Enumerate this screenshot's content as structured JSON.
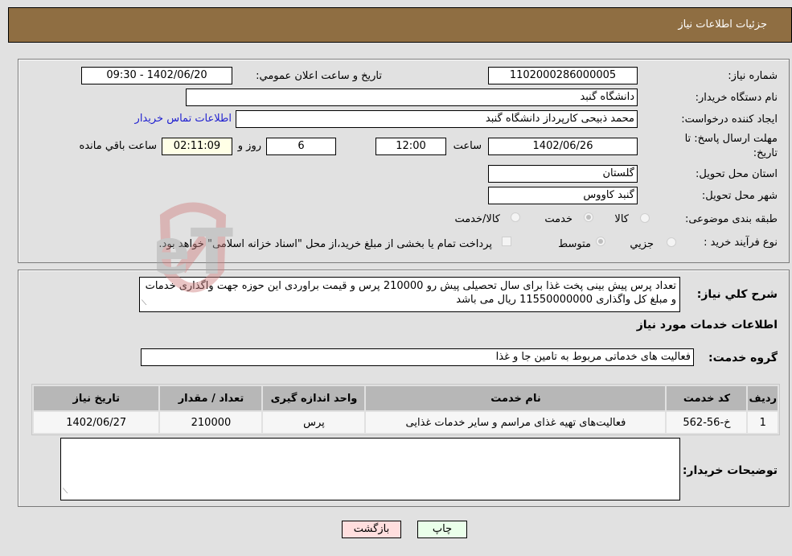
{
  "header": {
    "title": "جزئيات اطلاعات نياز"
  },
  "form": {
    "need_number": {
      "label": "شماره نياز:",
      "value": "1102000286000005"
    },
    "announce": {
      "label": "تاريخ و ساعت اعلان عمومي:",
      "value": "1402/06/20 - 09:30"
    },
    "buyer_org": {
      "label": "نام دستگاه خريدار:",
      "value": "دانشگاه گنبد"
    },
    "creator": {
      "label": "ايجاد کننده درخواست:",
      "value": "محمد ذبیحی کارپرداز دانشگاه گنبد",
      "contact_link": "اطلاعات تماس خريدار"
    },
    "deadline": {
      "label_line1": "مهلت ارسال پاسخ: تا",
      "label_line2": "تاريخ:",
      "date": "1402/06/26",
      "time_label": "ساعت",
      "time": "12:00",
      "days": "6",
      "days_label": "روز و",
      "remaining": "02:11:09",
      "remaining_label": "ساعت باقي مانده"
    },
    "province": {
      "label": "استان محل تحويل:",
      "value": "گلستان"
    },
    "city": {
      "label": "شهر محل تحويل:",
      "value": "گنبد کاووس"
    },
    "category": {
      "label": "طبقه بندی موضوعی:",
      "options": [
        "کالا",
        "خدمت",
        "کالا/خدمت"
      ],
      "selected": "خدمت"
    },
    "process": {
      "label": "نوع فرآيند خريد :",
      "options": [
        "جزيي",
        "متوسط"
      ],
      "selected": "متوسط",
      "treasury_note": "پرداخت تمام يا بخشی از مبلغ خريد،از محل \"اسناد خزانه اسلامی\" خواهد بود.",
      "treasury_checked": false
    }
  },
  "details": {
    "summary_label": "شرح کلي نياز:",
    "summary": "تعداد پرس پیش بینی پخت غذا برای سال تحصیلی پیش رو 210000 پرس و قیمت براوردی این حوزه جهت واگذاری خدمات و مبلغ کل واگذاری 11550000000 ریال می باشد",
    "services_title": "اطلاعات خدمات مورد نياز",
    "service_group_label": "گروه خدمت:",
    "service_group": "فعاليت های خدماتی مربوط به تامين جا و غذا",
    "table": {
      "headers": [
        "رديف",
        "کد خدمت",
        "نام خدمت",
        "واحد اندازه گيری",
        "تعداد / مقدار",
        "تاريخ نياز"
      ],
      "rows": [
        [
          "1",
          "خ-56-562",
          "فعالیت‌های تهیه غذای مراسم و سایر خدمات غذایی",
          "پرس",
          "210000",
          "1402/06/27"
        ]
      ]
    },
    "buyer_notes_label": "توضيحات خريدار:",
    "buyer_notes": ""
  },
  "buttons": {
    "print": "چاپ",
    "back": "بازگشت"
  },
  "watermark": {
    "text": "AriaTender.neT",
    "color": "#d9a0a0"
  }
}
